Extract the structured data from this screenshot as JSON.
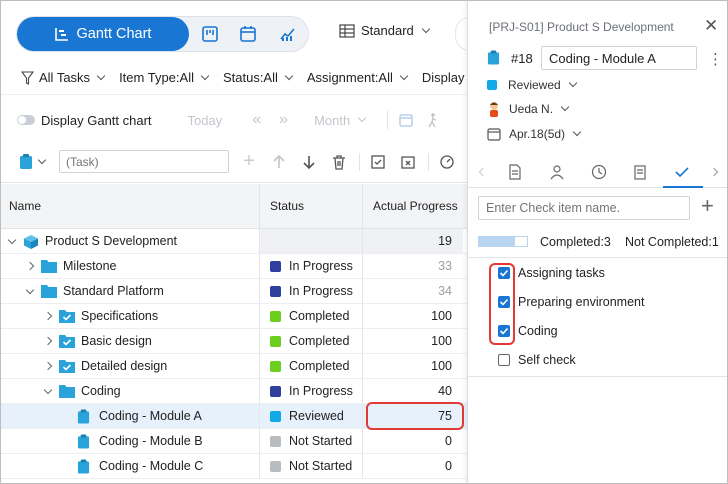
{
  "toolbar": {
    "gantt_label": "Gantt Chart",
    "view_label": "Standard"
  },
  "filters": [
    {
      "label": "All Tasks"
    },
    {
      "label": "Item Type:All"
    },
    {
      "label": "Status:All"
    },
    {
      "label": "Assignment:All"
    },
    {
      "label": "Display"
    }
  ],
  "gantt_bar": {
    "display_label": "Display Gantt chart",
    "today_label": "Today",
    "scale_label": "Month"
  },
  "task_bar": {
    "input_placeholder": "(Task)"
  },
  "grid": {
    "columns": {
      "name": "Name",
      "status": "Status",
      "progress": "Actual Progress"
    },
    "rows": [
      {
        "level": 0,
        "toggle": "expanded",
        "icon": "cube-icon",
        "name": "Product S Development",
        "status": "",
        "status_color": "",
        "progress": "19",
        "summary": true,
        "muted": false,
        "selected": false
      },
      {
        "level": 1,
        "toggle": "collapsed",
        "icon": "folder-icon",
        "name": "Milestone",
        "status": "In Progress",
        "status_color": "#2e3f9e",
        "progress": "33",
        "summary": false,
        "muted": true,
        "selected": false
      },
      {
        "level": 1,
        "toggle": "expanded",
        "icon": "folder-icon",
        "name": "Standard Platform",
        "status": "In Progress",
        "status_color": "#2e3f9e",
        "progress": "34",
        "summary": false,
        "muted": true,
        "selected": false
      },
      {
        "level": 2,
        "toggle": "collapsed",
        "icon": "folder-check-icon",
        "name": "Specifications",
        "status": "Completed",
        "status_color": "#6ccf1f",
        "progress": "100",
        "summary": false,
        "muted": false,
        "selected": false
      },
      {
        "level": 2,
        "toggle": "collapsed",
        "icon": "folder-check-icon",
        "name": "Basic design",
        "status": "Completed",
        "status_color": "#6ccf1f",
        "progress": "100",
        "summary": false,
        "muted": false,
        "selected": false
      },
      {
        "level": 2,
        "toggle": "collapsed",
        "icon": "folder-check-icon",
        "name": "Detailed design",
        "status": "Completed",
        "status_color": "#6ccf1f",
        "progress": "100",
        "summary": false,
        "muted": false,
        "selected": false
      },
      {
        "level": 2,
        "toggle": "expanded",
        "icon": "folder-icon",
        "name": "Coding",
        "status": "In Progress",
        "status_color": "#2e3f9e",
        "progress": "40",
        "summary": false,
        "muted": false,
        "selected": false
      },
      {
        "level": 3,
        "toggle": "none",
        "icon": "task-icon",
        "name": "Coding - Module A",
        "status": "Reviewed",
        "status_color": "#12a9e8",
        "progress": "75",
        "summary": false,
        "muted": false,
        "selected": true
      },
      {
        "level": 3,
        "toggle": "none",
        "icon": "task-icon",
        "name": "Coding - Module B",
        "status": "Not Started",
        "status_color": "#b9bcbf",
        "progress": "0",
        "summary": false,
        "muted": false,
        "selected": false
      },
      {
        "level": 3,
        "toggle": "none",
        "icon": "task-icon",
        "name": "Coding - Module C",
        "status": "Not Started",
        "status_color": "#b9bcbf",
        "progress": "0",
        "summary": false,
        "muted": false,
        "selected": false
      }
    ]
  },
  "panel": {
    "ref": "[PRJ-S01] Product S Development",
    "number": "#18",
    "title": "Coding - Module A",
    "status": "Reviewed",
    "status_color": "#12a9e8",
    "assignee": "Ueda N.",
    "date": "Apr.18(5d)",
    "check_placeholder": "Enter Check item name.",
    "progress_fraction": 0.75,
    "completed": "Completed:3",
    "not_completed": "Not Completed:1",
    "checklist": [
      {
        "label": "Assigning tasks",
        "checked": true
      },
      {
        "label": "Preparing environment",
        "checked": true
      },
      {
        "label": "Coding",
        "checked": true
      },
      {
        "label": "Self check",
        "checked": false
      }
    ]
  },
  "colors": {
    "accent": "#1976d2",
    "highlight": "#e53935",
    "folder": "#29a3da"
  }
}
